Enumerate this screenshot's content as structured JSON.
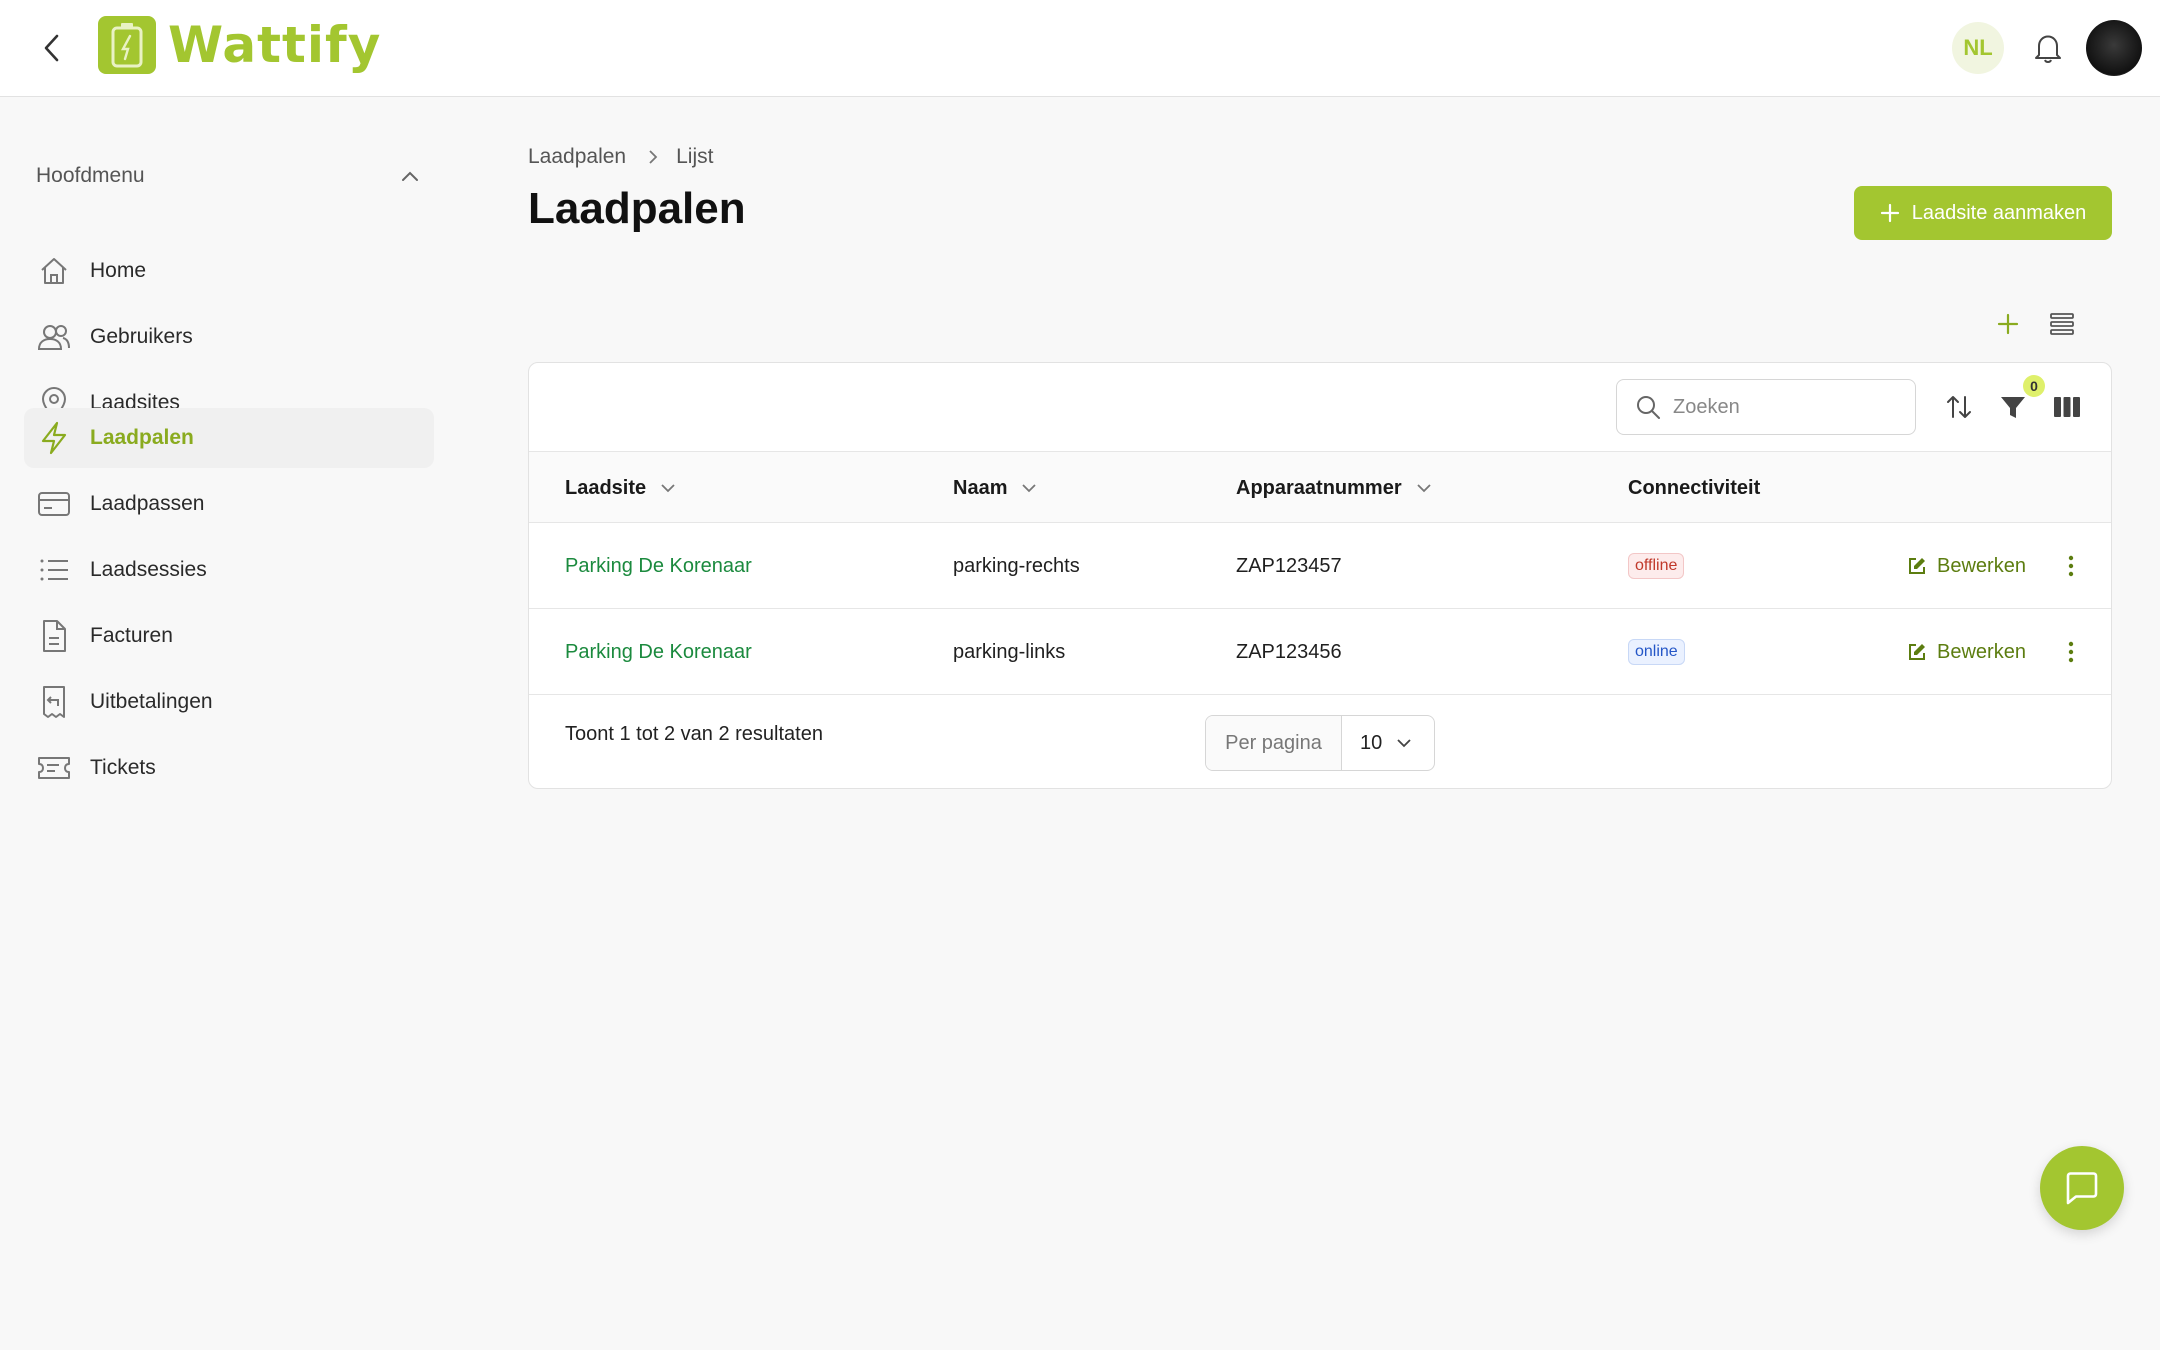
{
  "app": {
    "name": "Wattify",
    "brand_color": "#a3c630",
    "language": "NL"
  },
  "sidebar": {
    "section_title": "Hoofdmenu",
    "items": [
      {
        "label": "Home",
        "icon": "home-icon"
      },
      {
        "label": "Gebruikers",
        "icon": "users-icon"
      },
      {
        "label": "Laadsites",
        "icon": "map-pin-icon"
      },
      {
        "label": "Laadpalen",
        "icon": "lightning-icon",
        "active": true
      },
      {
        "label": "Laadpassen",
        "icon": "card-icon"
      },
      {
        "label": "Laadsessies",
        "icon": "list-icon"
      },
      {
        "label": "Facturen",
        "icon": "document-icon"
      },
      {
        "label": "Uitbetalingen",
        "icon": "receipt-icon"
      },
      {
        "label": "Tickets",
        "icon": "ticket-icon"
      }
    ]
  },
  "breadcrumb": {
    "items": [
      "Laadpalen",
      "Lijst"
    ]
  },
  "page": {
    "title": "Laadpalen",
    "create_button": "Laadsite aanmaken"
  },
  "table": {
    "search_placeholder": "Zoeken",
    "filter_count": "0",
    "columns": [
      "Laadsite",
      "Naam",
      "Apparaatnummer",
      "Connectiviteit"
    ],
    "rows": [
      {
        "laadsite": "Parking De Korenaar",
        "naam": "parking-rechts",
        "apparaatnummer": "ZAP123457",
        "connectiviteit": "offline",
        "action": "Bewerken"
      },
      {
        "laadsite": "Parking De Korenaar",
        "naam": "parking-links",
        "apparaatnummer": "ZAP123456",
        "connectiviteit": "online",
        "action": "Bewerken"
      }
    ],
    "footer": {
      "results_text": "Toont 1 tot 2 van 2 resultaten",
      "per_page_label": "Per pagina",
      "per_page_value": "10"
    }
  }
}
